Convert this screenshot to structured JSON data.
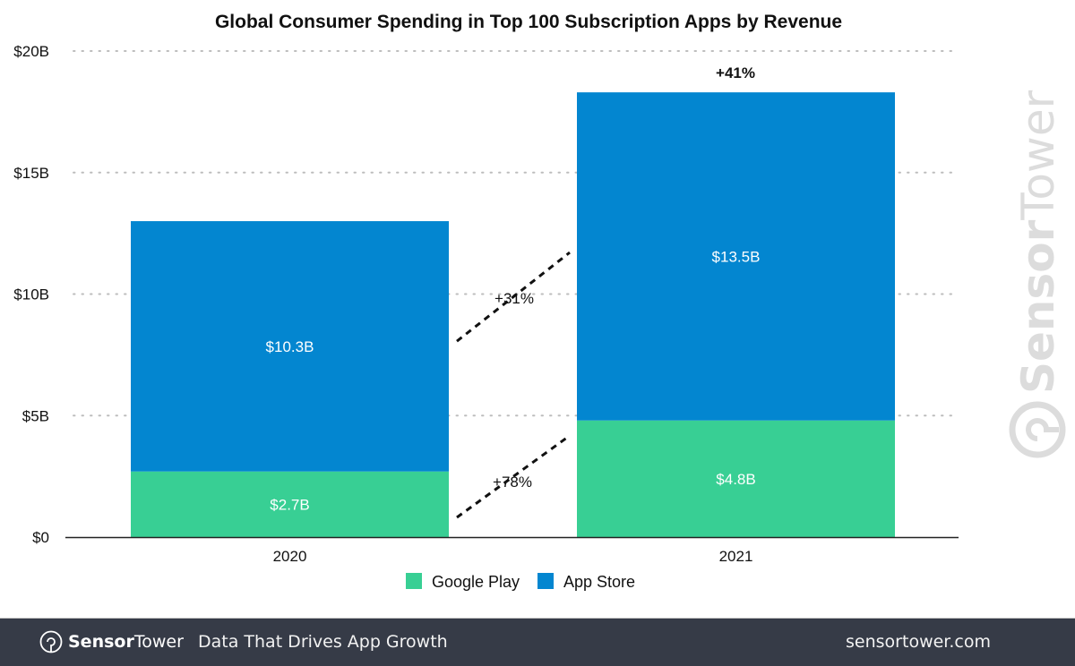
{
  "chart_data": {
    "type": "bar",
    "stacked": true,
    "title": "Global Consumer Spending in Top 100 Subscription Apps by Revenue",
    "xlabel": "",
    "ylabel": "",
    "categories": [
      "2020",
      "2021"
    ],
    "series": [
      {
        "name": "Google Play",
        "values": [
          2.7,
          4.8
        ],
        "labels": [
          "$2.7B",
          "$4.8B"
        ],
        "color": "#38cf94"
      },
      {
        "name": "App Store",
        "values": [
          10.3,
          13.5
        ],
        "labels": [
          "$10.3B",
          "$13.5B"
        ],
        "color": "#0386d0"
      }
    ],
    "ylim": [
      0,
      20
    ],
    "yticks": [
      0,
      5,
      10,
      15,
      20
    ],
    "ytick_labels": [
      "$0",
      "$5B",
      "$10B",
      "$15B",
      "$20B"
    ],
    "grid": true,
    "legend_position": "bottom-center",
    "annotations": {
      "total_growth": "+41%",
      "app_store_growth": "+31%",
      "google_play_growth": "+78%"
    }
  },
  "watermark": {
    "text_bold": "Sensor",
    "text_light": "Tower"
  },
  "footer": {
    "brand_bold": "Sensor",
    "brand_light": "Tower",
    "tagline": "Data That Drives App Growth",
    "website": "sensortower.com"
  }
}
